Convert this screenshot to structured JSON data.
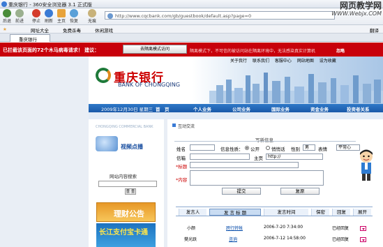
{
  "window": {
    "title": "重庆银行 - 360安全浏览器 3.1 正式版"
  },
  "watermark": {
    "line1": "网页教学网",
    "line2": "WWW.Webjx.COM"
  },
  "toolbar": {
    "back": "后退",
    "forward": "前进",
    "stop": "停止",
    "refresh": "刷新",
    "home": "主页",
    "restore": "恢复",
    "nohistory": "无痕"
  },
  "address": {
    "url": "http://www.cqcbank.com/gb/guestbook/default.asp?page=0"
  },
  "favbar": {
    "site_list": "网址大全",
    "free_killer": "免费杀毒",
    "leisure_game": "休闲游戏",
    "translate": "翻译"
  },
  "tabs": [
    {
      "label": "重庆银行"
    }
  ],
  "alert": {
    "message": "已拦截该页面的72个木马病毒请求！ 建议：",
    "button": "去隔离模式访问",
    "note": "隔离模式下，不可信的被访问站在隔离环境中，无法感染真实计算机",
    "ignore": "忽略"
  },
  "bank": {
    "top_links": [
      "关于我行",
      "联系我们",
      "客服中心",
      "网站地图",
      "设为收藏"
    ],
    "logo_cn": "重庆银行",
    "logo_en": "BANK OF CHONGQING",
    "date": "2009年12月30日 星期三",
    "menu": [
      "首　页",
      "个人业务",
      "公司业务",
      "国际业务",
      "资金业务",
      "投资者关系"
    ]
  },
  "sidebar": {
    "header": "CHONGQING COMMERCIAL BANK",
    "video_label": "视频点播",
    "search_title": "网站内容搜索",
    "search_button": "查 查"
  },
  "ads": {
    "ad1": "理财公告",
    "ad2": "长江支付宝卡通"
  },
  "main": {
    "breadcrumb": "互动交流",
    "form": {
      "title": "写新信息",
      "name_label": "姓名",
      "nature_label": "信息性质：",
      "nature_public": "公开",
      "nature_private": "悄悄话",
      "gender_label": "性别",
      "gender_value": "男",
      "expression_label": "表情",
      "expression_value": "平常心",
      "mail_label": "信箱",
      "homepage_label": "主页",
      "homepage_value": "http://",
      "title_label": "*标题",
      "content_label": "*内容",
      "submit": "提交",
      "reset": "复原"
    },
    "table": {
      "headers": [
        "发言人",
        "发 言 标 题",
        "发言时间",
        "保密",
        "回复",
        "展开"
      ],
      "rows": [
        {
          "author": "小颜",
          "title": "跨行转帐",
          "time": "2006-7-20 7:34:00",
          "status": "已经回复"
        },
        {
          "author": "樊光跃",
          "title": "咨询",
          "time": "2006-7-12 14:58:00",
          "status": "已经回复"
        }
      ]
    }
  }
}
